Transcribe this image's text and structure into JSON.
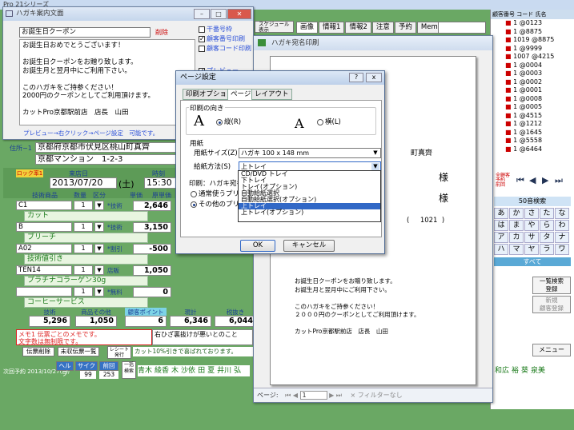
{
  "app": {
    "title": "Pro 21シリーズ",
    "tabs": [
      "画像",
      "情報1",
      "情報2",
      "注意",
      "予約",
      "Memo"
    ],
    "small_tab": "カルテ",
    "schedule_btn": "スケジュール\n表示",
    "right_header": [
      "顧客番号",
      "コード",
      "氏名"
    ],
    "code_list": [
      {
        "no": "1",
        "code": "@0123"
      },
      {
        "no": "1",
        "code": "@8875"
      },
      {
        "no": "1019",
        "code": "@8875"
      },
      {
        "no": "1",
        "code": "@9999"
      },
      {
        "no": "1007",
        "code": "@4215"
      },
      {
        "no": "1",
        "code": "@0004"
      },
      {
        "no": "1",
        "code": "@0003"
      },
      {
        "no": "1",
        "code": "@0002"
      },
      {
        "no": "1",
        "code": "@0001"
      },
      {
        "no": "1",
        "code": "@0008"
      },
      {
        "no": "1",
        "code": "@0005"
      },
      {
        "no": "1",
        "code": "@4515"
      },
      {
        "no": "1",
        "code": "@1212"
      },
      {
        "no": "1",
        "code": "@1645"
      },
      {
        "no": "1",
        "code": "@5558"
      },
      {
        "no": "1",
        "code": "@6464"
      }
    ],
    "search_btn": "50音検索",
    "kana_rows": [
      [
        "あ",
        "か",
        "さ",
        "た",
        "な"
      ],
      [
        "は",
        "ま",
        "や",
        "ら",
        "わ"
      ],
      [
        "ア",
        "カ",
        "サ",
        "タ",
        "ナ"
      ],
      [
        "ハ",
        "マ",
        "ヤ",
        "ラ",
        "ワ"
      ]
    ],
    "all_btn": "すべて",
    "list_btn": "一覧検索\n登録",
    "new_btn": "新規\n顧客登録",
    "menu_btn": "メニュー",
    "bottom_names": [
      "青木",
      "綾香",
      "木",
      "沙依",
      "田",
      "夏",
      "井川",
      "弘",
      "和広",
      "裕",
      "葵",
      "泉美"
    ]
  },
  "memo_window": {
    "title": "ハガキ案内文面",
    "subject": "お誕生日クーポン",
    "delete_label": "削除",
    "body": "お誕生日おめでとうございます！\n\nお誕生日クーポンをお贈り致します。\nお誕生月と翌月中にご利用下さい。\n\nこのハガキをご持参ください！\n2000円のクーポンとしてご利用頂けます。\n\nカットPro京都駅前店　店長　山田",
    "options": [
      {
        "label": "干番号枠",
        "checked": false
      },
      {
        "label": "顧客番号印刷",
        "checked": true
      },
      {
        "label": "顧客コード印刷",
        "checked": false
      },
      {
        "label": "プレビュー",
        "checked": true
      }
    ],
    "hint": "プレビュー→右クリック→ページ設定　可能です。"
  },
  "customer": {
    "address_label": "住所−1",
    "address1": "京都府京都市伏見区桃山町真齊",
    "address2": "京都マンション　1-2-3",
    "lock_label": "ロック率1",
    "visit_label": "来店日",
    "visit_date": "2013/07/20",
    "weekday": "(土)",
    "time_label": "時刻",
    "time": "15:30",
    "columns": [
      "技術商品",
      "数量",
      "区分",
      "単価",
      "原単価"
    ],
    "rows": [
      {
        "code": "C1",
        "qty": "1",
        "cat": "*技術",
        "price": "2,646",
        "name": "カット"
      },
      {
        "code": "B",
        "qty": "1",
        "cat": "*技術",
        "price": "3,150",
        "name": "ブリーチ"
      },
      {
        "code": "A02",
        "qty": "1",
        "cat": "*割引",
        "price": "-500",
        "name": "技術値引き"
      },
      {
        "code": "TEN14",
        "qty": "1",
        "cat": "店販",
        "price": "1,050",
        "name": "プラチナコラーゲン30g"
      },
      {
        "code": "",
        "qty": "1",
        "cat": "*無料",
        "price": "0",
        "name": "コーヒーサービス"
      }
    ],
    "totals_labels": [
      "技術",
      "商品その他",
      "顧客ポイント",
      "現計",
      "税抜き"
    ],
    "totals": [
      "5,296",
      "1,050",
      "6",
      "6,346",
      "6,044"
    ],
    "memo_text": "メモ1 伝票ごとのメモです。\n文字数は無制限です。",
    "note_text": "右ひざ裏抜けが悪いとのこと",
    "slip_btn": "伝票削除",
    "unpaid_btn": "未収伝票一覧",
    "receipt_btn": "レシート\n発行",
    "coupon_text": "カット10%引きで喜ばれております。",
    "next_visit": "次回予約 2013/10/27(日)",
    "footer_buttons": [
      "ヘルプ",
      "サイクル",
      "前回",
      "一括\n検索"
    ],
    "footer_vals": [
      "99",
      "253"
    ]
  },
  "preview_window": {
    "title": "ハガキ宛名印刷",
    "address": "町真齊",
    "honorific1": "様",
    "honorific2": "様",
    "customer_no": "1021",
    "message": "お誕生日クーポンをお贈り致します。\nお誕生月と翌月中にご利用下さい。\n\nこのハガキをご持参ください！\n２０００円のクーポンとしてご利用頂けます。\n\nカットPro京都駅前店　店長　山田",
    "page_label": "ページ:",
    "page_value": "1",
    "filter_label": "フィルターなし"
  },
  "dialog": {
    "title": "ページ設定",
    "tabs": [
      "印刷オプション",
      "ページ",
      "レイアウト"
    ],
    "orientation_label": "印刷の向き",
    "portrait": "縦(R)",
    "landscape": "横(L)",
    "paper_label": "用紙",
    "size_label": "用紙サイズ(Z)",
    "size_value": "ハガキ 100 x 148 mm",
    "source_label": "給紙方法(S)",
    "source_value": "上トレイ",
    "printer_label": "印刷：ハガキ宛名",
    "printer_opt1": "通常使うプリン",
    "printer_opt2": "その他のプリン",
    "source_options": [
      "CD/DVD トレイ",
      "下トレイ",
      "トレイ(オプション)",
      "自動給紙選択",
      "自動給紙選択(オプション)",
      "上トレイ",
      "上トレイ(オプション)"
    ],
    "ok": "OK",
    "cancel": "キャンセル",
    "help": "?",
    "close": "x"
  }
}
